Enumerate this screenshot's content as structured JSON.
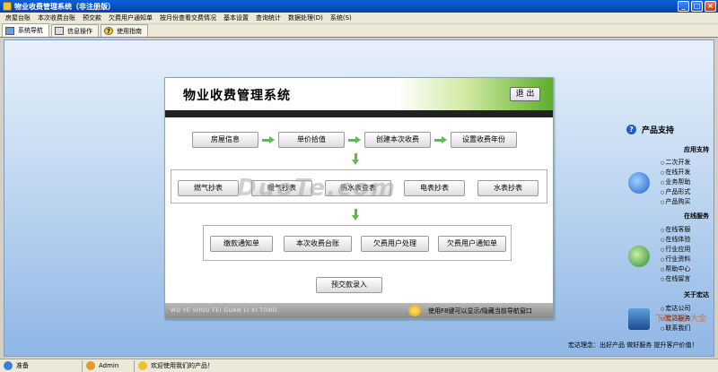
{
  "window": {
    "title": "物业收费管理系统（非注册版）",
    "buttons": [
      "_",
      "□",
      "×"
    ]
  },
  "menu": [
    "房屋台账",
    "本次收费台账",
    "预交款",
    "欠费用户通知单",
    "按月份查看交费情况",
    "基本设置",
    "查询统计",
    "数据处理(D)",
    "系统(S)"
  ],
  "tabs": [
    {
      "label": "系统导航",
      "icon": "nav-icon"
    },
    {
      "label": "信息操作",
      "icon": "info-icon"
    },
    {
      "label": "使用指南",
      "icon": "help-icon"
    }
  ],
  "panel": {
    "title": "物业收费管理系统",
    "exit": "退 出",
    "row1": [
      "房屋信息",
      "单价拾值",
      "创建本次收费",
      "设置收费年份"
    ],
    "row2": [
      "燃气抄表",
      "暖气抄表",
      "热水表查表",
      "电表抄表",
      "水表抄表"
    ],
    "row3": [
      "缴款通知单",
      "本次收费台账",
      "欠费用户处理",
      "欠费用户通知单"
    ],
    "prepay": "预交款录入",
    "footer_en": "WU YE SHOU FEI GUAN LI XI TONG",
    "footer_tip": "使用F8键可以显示/隐藏当前导航窗口"
  },
  "watermark": "DuoTe.com",
  "sidebar": {
    "heading": "产品支持",
    "sections": [
      {
        "title": "应用支持",
        "links": [
          "二次开发",
          "在线开发",
          "业务帮助",
          "产品形式",
          "产品购买"
        ]
      },
      {
        "title": "在线服务",
        "links": [
          "在线客服",
          "在线体验",
          "行业应用",
          "行业资料",
          "帮助中心",
          "在线留言"
        ]
      },
      {
        "title": "关于宏达",
        "links": [
          "宏达公司",
          "宏达服务",
          "联系我们"
        ]
      }
    ]
  },
  "slogan": "宏达理念：出好产品 做好服务 提升客户价值！",
  "brand_watermark": "下载天堂 大全",
  "status": {
    "ready": "准备",
    "user": "Admin",
    "welcome": "欢迎使用我们的产品！"
  }
}
